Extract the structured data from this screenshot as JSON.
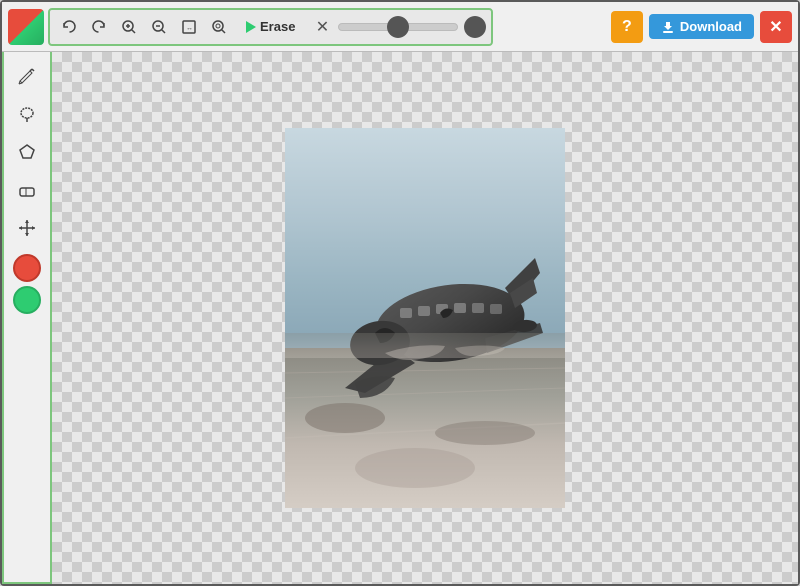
{
  "header": {
    "toolbar": {
      "undo_label": "↩",
      "redo_label": "↪",
      "zoom_in_label": "+",
      "zoom_out_label": "−",
      "zoom_fit_label": "⊡",
      "zoom_actual_label": "⊠",
      "erase_label": "Erase",
      "cancel_label": "✕",
      "brush_value": 50
    },
    "help_label": "?",
    "download_label": "Download",
    "close_label": "✕"
  },
  "sidebar": {
    "tools": [
      {
        "name": "pencil",
        "icon": "✏",
        "label": "Draw"
      },
      {
        "name": "lasso",
        "icon": "⌀",
        "label": "Lasso"
      },
      {
        "name": "polygon",
        "icon": "△",
        "label": "Polygon"
      },
      {
        "name": "eraser",
        "icon": "◻",
        "label": "Eraser"
      },
      {
        "name": "move",
        "icon": "✛",
        "label": "Move"
      }
    ],
    "colors": [
      {
        "name": "foreground",
        "value": "#e74c3c"
      },
      {
        "name": "background",
        "value": "#2ecc71"
      }
    ]
  },
  "canvas": {
    "image_alt": "Crashed airplane in snowy landscape"
  }
}
